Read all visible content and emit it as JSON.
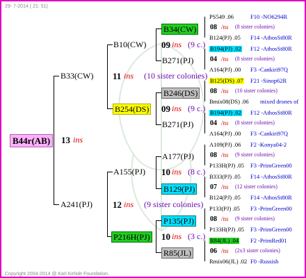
{
  "date": "29- 7-2014 ( 21: 51)",
  "copyright": "Copyright 2004-2014 @ Karl Kehde Foundation.",
  "colors": {
    "frame": "#e000c0",
    "green": "#22cc22",
    "cyan": "#00e0ff",
    "yellow": "#ffff00",
    "gray": "#c0c0c0",
    "root": "#ffb0ff",
    "red": "#e00000",
    "blue": "#0000cc"
  },
  "root": {
    "name": "B44r(AB)",
    "num": "13",
    "ins": "ins"
  },
  "g1": [
    {
      "name": "B33(CW)",
      "num": "11",
      "ins": "ins",
      "sis": "(10 sister colonies)"
    },
    {
      "name": "A241(PJ)",
      "num": "12",
      "ins": "ins",
      "sis": "(9 sister colonies)"
    }
  ],
  "g2": [
    {
      "name": "B10(CW)",
      "num": "09",
      "ins": "ins",
      "sis": "(9 c.)"
    },
    {
      "name": "B254(DS)",
      "num": "09",
      "ins": "ins",
      "sis": "(9 c.)"
    },
    {
      "name": "A155(PJ)",
      "num": "10",
      "ins": "ins",
      "sis": "(8 c.)"
    },
    {
      "name": "P216H(PJ)",
      "num": "10",
      "ins": "ins",
      "sis": "(3 c.)"
    }
  ],
  "g3": [
    "B34(CW)",
    "B271(PJ)",
    "B246(DS)",
    "B271(PJ)",
    "A177(PJ)",
    "B129(PJ)",
    "P135(PJ)",
    "R85(JL)"
  ],
  "g4": [
    {
      "a": "PS549 .06",
      "b": "F10 -NO6294R"
    },
    {
      "n": "08",
      "ins": "/ns",
      "s": "(8 sister colonies)"
    },
    {
      "a": "B124(PJ) .05",
      "b": "F14 -AthosSt80R"
    },
    {
      "a": "B194(PJ) .02",
      "b": "F12 -AthosSt80R"
    },
    {
      "n": "04",
      "ins": "/ns",
      "s": "(8 sister colonies)"
    },
    {
      "a": "A164(PJ) .00",
      "b": "F3 -Cankiri97Q"
    },
    {
      "a": "B125(DS) .07",
      "b": "F21 -Sinop62R"
    },
    {
      "n": "08",
      "ins": "/ns",
      "s": "(10 sister colonies)"
    },
    {
      "a": "Bmix08(DS) .06",
      "b": "mixed drones of"
    },
    {
      "a": "B194(PJ) .02",
      "b": "F12 -AthosSt80R"
    },
    {
      "n": "04",
      "ins": "/ns",
      "s": "(8 sister colonies)"
    },
    {
      "a": "A164(PJ) .00",
      "b": "F3 -Cankiri97Q"
    },
    {
      "a": "A109(PJ) .06",
      "b": "F2 -Konya04-2"
    },
    {
      "n": "08",
      "ins": "/ns",
      "s": "(9 sister colonies)"
    },
    {
      "a": "P133H(PJ) .05",
      "b": "F3 -PrimGreen00"
    },
    {
      "a": "B333(PJ) .05",
      "b": "F14 -AthosSt80R"
    },
    {
      "n": "07",
      "ins": "/ns",
      "s": "(12 sister colonies)"
    },
    {
      "a": "B124(PJ) .05",
      "b": "F14 -AthosSt80R"
    },
    {
      "a": "P133(PJ) .05",
      "b": "F3 -PrimGreen00"
    },
    {
      "n": "08",
      "ins": "/ns",
      "s": "(9 sister colonies)"
    },
    {
      "a": "P133H(PJ) .05",
      "b": "F3 -PrimGreen00"
    },
    {
      "a": "R84(JL) .04",
      "b": "F2 -PrimRed01"
    },
    {
      "n": "06",
      "ins": "/ns",
      "s": "(2x3 sister colonies)"
    },
    {
      "a": "Rmix06(JL) .02",
      "b": "F0 -Russish"
    }
  ]
}
